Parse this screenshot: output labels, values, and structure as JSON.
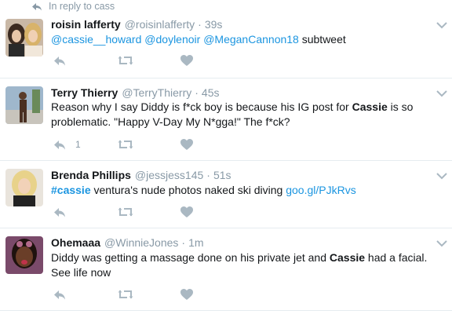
{
  "reply_context": {
    "text": "In reply to cass"
  },
  "tweets": [
    {
      "name": "roisin lafferty",
      "handle": "@roisinlafferty",
      "separator": "·",
      "time": "39s",
      "mentions": [
        "@cassie__howard",
        "@doylenoir",
        "@MeganCannon18"
      ],
      "suffix": "subtweet",
      "reply_count": ""
    },
    {
      "name": "Terry Thierry",
      "handle": "@TerryThierry",
      "separator": "·",
      "time": "45s",
      "text_before": "Reason why I say Diddy is f*ck boy is because his IG post for ",
      "bold": "Cassie",
      "text_after": " is so problematic. \"Happy V-Day My N*gga!\" The f*ck?",
      "reply_count": "1"
    },
    {
      "name": "Brenda Phillips",
      "handle": "@jessjess145",
      "separator": "·",
      "time": "51s",
      "hashtag": "#cassie",
      "text_middle": " ventura's nude photos naked ski diving ",
      "url": "goo.gl/PJkRvs",
      "reply_count": ""
    },
    {
      "name": "Ohemaaa",
      "handle": "@WinnieJones",
      "separator": "·",
      "time": "1m",
      "text_before": "Diddy was getting a massage done on his private jet and ",
      "bold": "Cassie",
      "text_after": " had a facial. See life now",
      "reply_count": ""
    }
  ],
  "colors": {
    "link": "#1b95e0",
    "muted": "#8899a6",
    "icon": "#aab8c2",
    "divider": "#e6ecf0"
  },
  "icons": [
    "reply-arrow-icon",
    "reply-icon",
    "retweet-icon",
    "like-heart-icon",
    "chevron-down-icon"
  ]
}
